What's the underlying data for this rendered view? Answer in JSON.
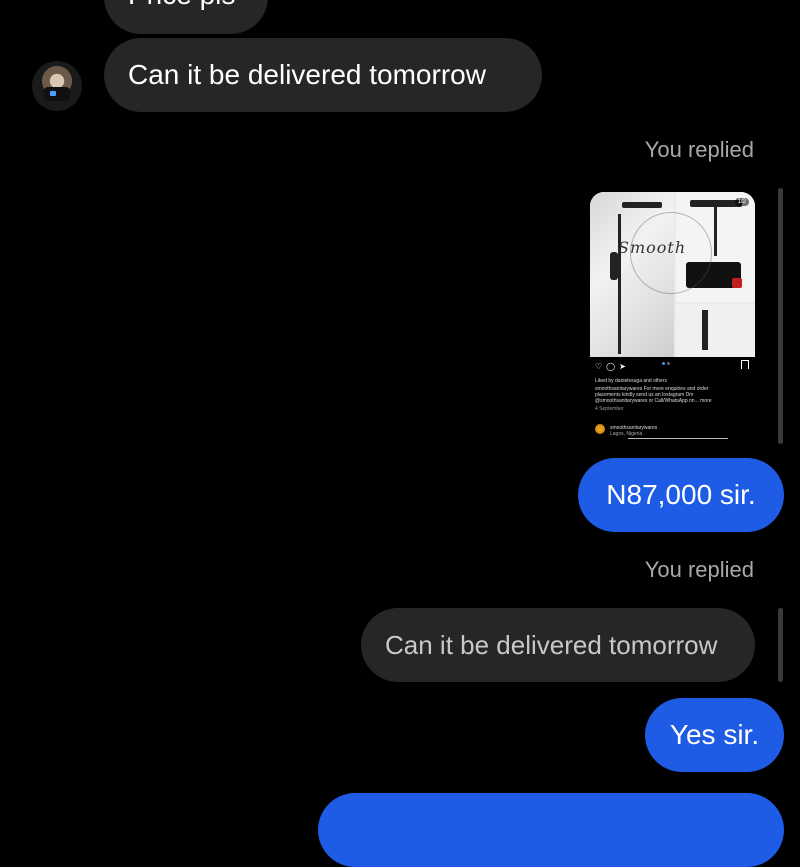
{
  "messages": {
    "top_partial": "Price pls",
    "incoming_1": "Can it be delivered tomorrow",
    "you_replied_1": "You replied",
    "reply_1": "N87,000 sir.",
    "you_replied_2": "You replied",
    "quoted_2": "Can it be delivered tomorrow",
    "reply_2": "Yes sir."
  },
  "shared_post": {
    "logo_text": "Smooth",
    "page_count": "1/2",
    "liked_by": "Liked by danielesuga and others",
    "caption_line1": "smoothsanitarywares For more enquiries and order",
    "caption_line2": "placements kindly send us an Instagram Dm",
    "caption_line3": "@smoothsanitarywares or Call/WhatsApp on... more",
    "date": "4 September",
    "account": "smoothsanitarywares",
    "location": "Lagos, Nigeria",
    "icons": [
      "heart-icon",
      "comment-icon",
      "share-icon",
      "bookmark-icon"
    ]
  },
  "colors": {
    "background": "#000000",
    "incoming_bubble": "#262626",
    "outgoing_bubble": "#3797f0",
    "muted_text": "#a8a8a8"
  }
}
